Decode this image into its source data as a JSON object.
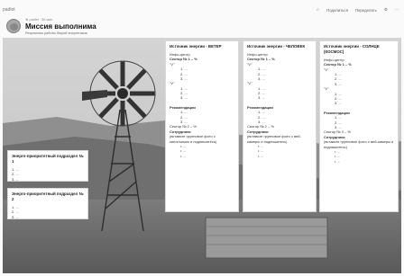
{
  "app": {
    "name": "padlet"
  },
  "header": {
    "breadcrumb": "★ padlet · 38 мин",
    "title": "Миссия выполнима",
    "subtitle": "Результаты работы бюрой энергетиков"
  },
  "toolbar": {
    "like": "☆",
    "share": "Поделиться",
    "remake": "Переделать",
    "settings": "⚙",
    "more": "⋯"
  },
  "cards": {
    "wind": {
      "title": "Источник энергии - ВЕТЕР",
      "info": "Инфо-центр",
      "sector1": "Сектор № 1 – %",
      "v1": "\"V\"",
      "items1": [
        "1. ...",
        "2. ...",
        "3. ..."
      ],
      "v2": "\"V\"",
      "items2": [
        "1. ...",
        "2. ...",
        "3. ..."
      ],
      "rec": "Рекомендации",
      "recitems": [
        "1. ...",
        "2. ...",
        "3. ..."
      ],
      "sector2": "Сектор № 2 – %",
      "staff": "Сотрудники",
      "staffnote": "(вставьте групповое фото с киносъемок и подпишитесь)",
      "bullets": [
        "• ...",
        "• ...",
        "• ..."
      ]
    },
    "human": {
      "title": "Источник энергии - ЧЕЛОВЕК",
      "info": "Инфо-центр",
      "sector1": "Сектор № 1 – %",
      "v1": "\"V\"",
      "items1": [
        "1. ...",
        "2. ...",
        "3. ..."
      ],
      "v2": "\"V\"",
      "items2": [
        "1. ...",
        "2. ...",
        "3. ..."
      ],
      "rec": "Рекомендации",
      "recitems": [
        "1. ...",
        "2. ...",
        "3. ..."
      ],
      "sector2": "Сектор № 2 – %",
      "staff": "Сотрудники",
      "staffnote": "(вставьте групповое фото с вей-камеры и подпишитесь)",
      "bullets": [
        "• ...",
        "• ...",
        "• ..."
      ]
    },
    "sun": {
      "title": "Источник энергии - СОЛНЦЕ (КОСМОС)",
      "info": "Инфо-центр",
      "sector1": "Сектор № 1 – %",
      "v1": "\"V\"",
      "items1": [
        "1. ...",
        "2. ...",
        "3. ..."
      ],
      "v2": "\"V\"",
      "items2": [
        "1. ...",
        "2. ...",
        "3. ..."
      ],
      "rec": "Рекомендации",
      "recitems": [
        "1. ...",
        "2. ...",
        "3. ..."
      ],
      "sector2": "Сектор № 3 – %",
      "staff": "Сотрудники",
      "staffnote": "(вставьте групповое фото с вей-камеры и подпишитесь)",
      "bullets": [
        "• ...",
        "• ...",
        "• ..."
      ]
    },
    "subdivision1": {
      "title": "Энерго-приоритетный подраздел № 1",
      "items": [
        "1. ...",
        "2. ...",
        "3. ..."
      ]
    },
    "subdivision2": {
      "title": "Энерго-приоритетный подраздел № 2",
      "items": [
        "1. ...",
        "2. ...",
        "3. ..."
      ]
    }
  }
}
